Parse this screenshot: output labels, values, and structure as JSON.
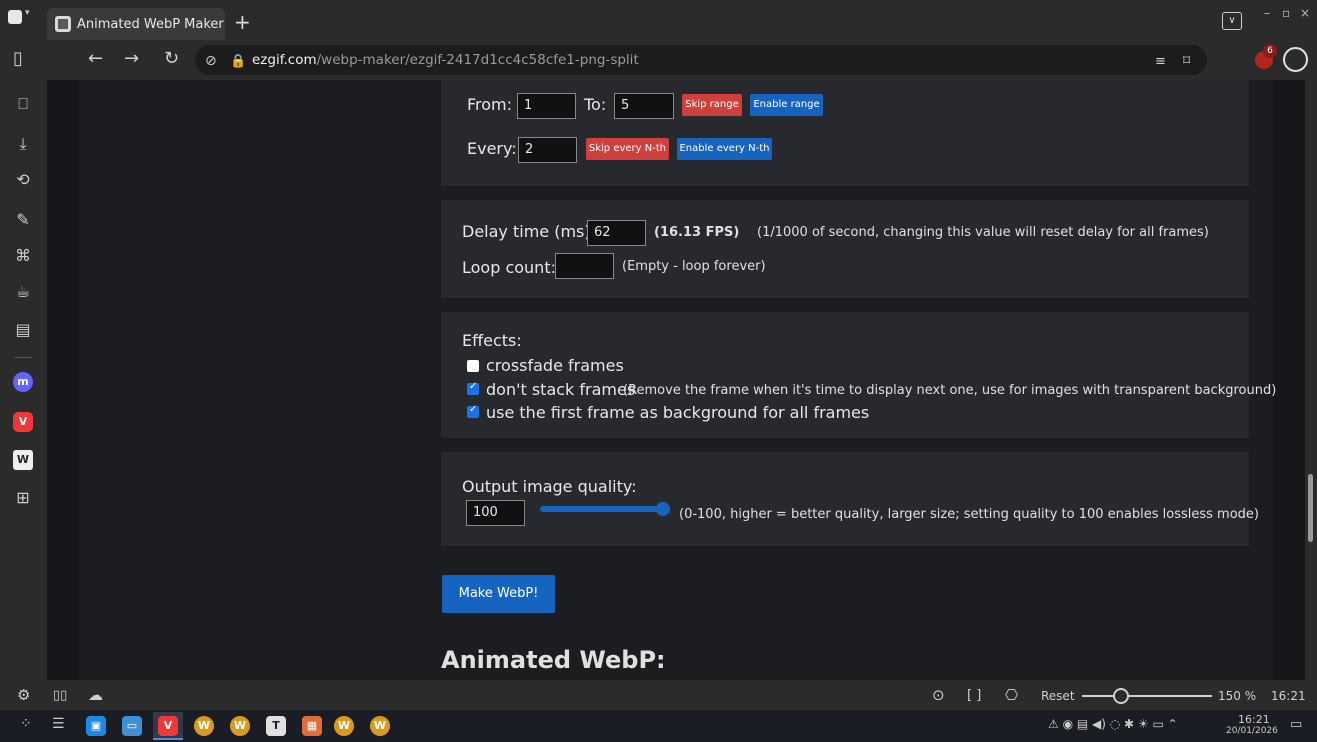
{
  "browser": {
    "tab_title": "Animated WebP Maker",
    "new_tab": "+",
    "url_domain": "ezgif.com",
    "url_path": "/webp-maker/ezgif-2417d1cc4c58cfe1-png-split",
    "ublock_count": "6",
    "window_controls": [
      "–",
      "▫",
      "×"
    ]
  },
  "range": {
    "from_label": "From:",
    "from_value": "1",
    "to_label": "To:",
    "to_value": "5",
    "skip_range": "Skip range",
    "enable_range": "Enable range",
    "every_label": "Every:",
    "every_value": "2",
    "skip_nth": "Skip every N-th",
    "enable_nth": "Enable every N-th"
  },
  "timing": {
    "delay_label": "Delay time (ms):",
    "delay_value": "62",
    "fps": "(16.13 FPS)",
    "delay_note": "(1/1000 of second, changing this value will reset delay for all frames)",
    "loop_label": "Loop count:",
    "loop_value": "",
    "loop_note": "(Empty - loop forever)"
  },
  "effects": {
    "title": "Effects:",
    "items": [
      {
        "label": "crossfade frames",
        "note": "",
        "checked": false
      },
      {
        "label": "don't stack frames",
        "note": "(Remove the frame when it's time to display next one, use for images with transparent background)",
        "checked": true
      },
      {
        "label": "use the first frame as background for all frames",
        "note": "",
        "checked": true
      }
    ]
  },
  "quality": {
    "label": "Output image quality:",
    "value": "100",
    "slider_level": 1.0,
    "note": "(0-100, higher = better quality, larger size; setting quality to 100 enables lossless mode)"
  },
  "make_button": "Make WebP!",
  "result_heading": "Animated WebP:",
  "statusbar": {
    "reset": "Reset",
    "zoom": "150 %",
    "clock": "16:21"
  },
  "taskbar": {
    "time": "16:21",
    "date": "20/01/2026"
  },
  "colors": {
    "accent_blue": "#1565c0",
    "danger_red": "#cf3f3b",
    "panel_bg": "#28292e"
  }
}
